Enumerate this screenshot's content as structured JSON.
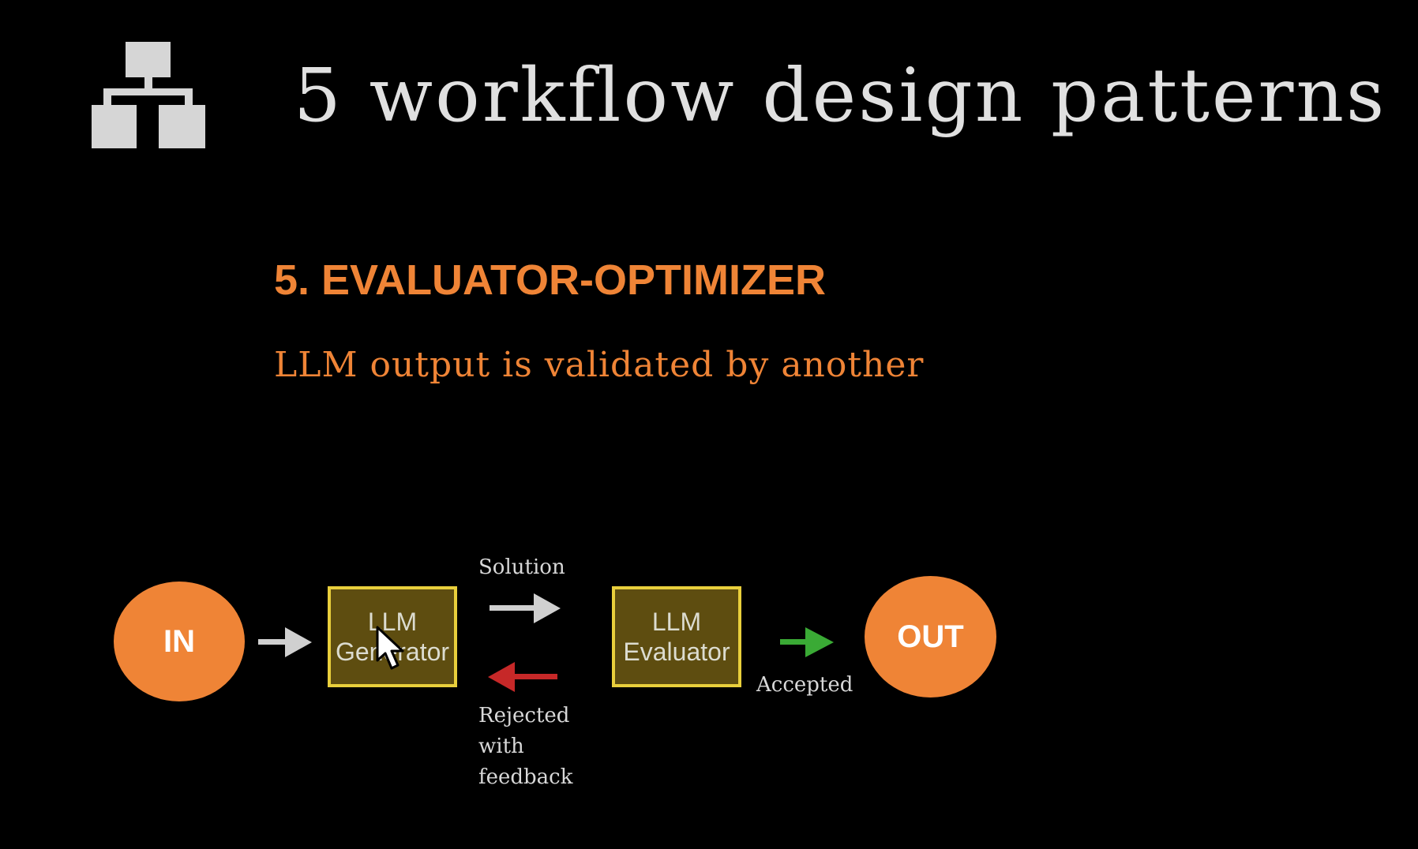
{
  "title": "5 workflow design patterns",
  "section": {
    "heading": "5. EVALUATOR-OPTIMIZER",
    "subtitle": "LLM output is validated by another"
  },
  "diagram": {
    "nodes": {
      "input": "IN",
      "generator": [
        "LLM",
        "Generator"
      ],
      "evaluator": [
        "LLM",
        "Evaluator"
      ],
      "output": "OUT"
    },
    "edges": {
      "solution": "Solution",
      "accepted": "Accepted",
      "rejected": [
        "Rejected",
        "with",
        "feedback"
      ]
    }
  },
  "colors": {
    "background": "#000000",
    "title": "#e0e0e0",
    "accent": "#ef8436",
    "box_fill": "#5e4d10",
    "box_border": "#e9cf3c",
    "arrow_default": "#d0d0d0",
    "arrow_rejected": "#c62828",
    "arrow_accepted": "#3aaa35"
  },
  "icons": {
    "header": "hierarchy-icon",
    "cursor": "mouse-pointer-icon"
  }
}
